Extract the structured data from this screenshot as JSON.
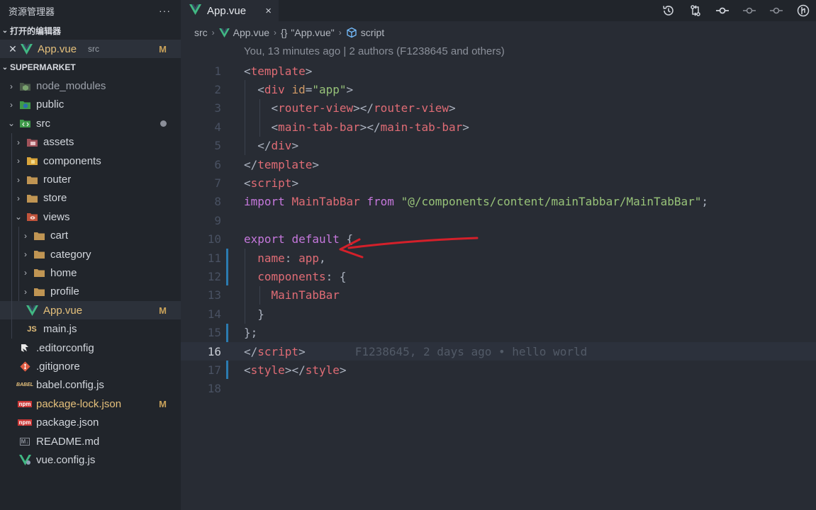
{
  "explorer": {
    "title": "资源管理器",
    "more_icon": "ellipsis-icon",
    "open_editors_label": "打开的编辑器",
    "open_editor": {
      "name": "App.vue",
      "folder": "src",
      "status": "M"
    },
    "project_label": "SUPERMARKET",
    "items": [
      {
        "name": "node_modules",
        "icon": "node-folder-icon",
        "chevron": "›"
      },
      {
        "name": "public",
        "icon": "public-folder-icon",
        "chevron": "›"
      },
      {
        "name": "src",
        "icon": "src-folder-icon",
        "chevron": "⌄"
      },
      {
        "name": "assets",
        "icon": "assets-folder-icon",
        "chevron": "›"
      },
      {
        "name": "components",
        "icon": "components-folder-icon",
        "chevron": "›"
      },
      {
        "name": "router",
        "icon": "folder-icon",
        "chevron": "›"
      },
      {
        "name": "store",
        "icon": "folder-icon",
        "chevron": "›"
      },
      {
        "name": "views",
        "icon": "views-folder-icon",
        "chevron": "⌄"
      },
      {
        "name": "cart",
        "icon": "folder-icon",
        "chevron": "›"
      },
      {
        "name": "category",
        "icon": "folder-icon",
        "chevron": "›"
      },
      {
        "name": "home",
        "icon": "folder-icon",
        "chevron": "›"
      },
      {
        "name": "profile",
        "icon": "folder-icon",
        "chevron": "›"
      },
      {
        "name": "App.vue",
        "icon": "vue-icon",
        "status": "M"
      },
      {
        "name": "main.js",
        "icon": "js-icon",
        "icon_text": "JS"
      },
      {
        "name": ".editorconfig",
        "icon": "editorconfig-icon"
      },
      {
        "name": ".gitignore",
        "icon": "git-icon"
      },
      {
        "name": "babel.config.js",
        "icon": "babel-icon",
        "icon_text": "BABEL"
      },
      {
        "name": "package-lock.json",
        "icon": "npm-icon",
        "icon_text": "npm",
        "status": "M"
      },
      {
        "name": "package.json",
        "icon": "npm-icon",
        "icon_text": "npm"
      },
      {
        "name": "README.md",
        "icon": "markdown-icon",
        "icon_text": "M↓"
      },
      {
        "name": "vue.config.js",
        "icon": "vue-config-icon"
      }
    ]
  },
  "editor": {
    "tab": {
      "label": "App.vue",
      "close": "×"
    },
    "breadcrumb": {
      "folder": "src",
      "file": "App.vue",
      "symbol_braces": "{}",
      "symbol": "\"App.vue\"",
      "leaf": "script"
    },
    "codelens": "You, 13 minutes ago | 2 authors (F1238645 and others)",
    "blame": "F1238645, 2 days ago • hello world",
    "current_line": 16,
    "action_icons": [
      "history-icon",
      "compare-changes-icon",
      "git-commit-icon",
      "previous-change-icon",
      "next-change-icon",
      "git-lens-icon"
    ],
    "lines": [
      {
        "n": "1",
        "code": [
          [
            "c-pun",
            "<"
          ],
          [
            "c-tag",
            "template"
          ],
          [
            "c-pun",
            ">"
          ]
        ]
      },
      {
        "n": "2",
        "code": [
          [
            "c-pun",
            "  <"
          ],
          [
            "c-tag",
            "div"
          ],
          [
            "c-pun",
            " "
          ],
          [
            "c-attr",
            "id"
          ],
          [
            "c-pun",
            "="
          ],
          [
            "c-str",
            "\"app\""
          ],
          [
            "c-pun",
            ">"
          ]
        ]
      },
      {
        "n": "3",
        "code": [
          [
            "c-pun",
            "    <"
          ],
          [
            "c-tag",
            "router-view"
          ],
          [
            "c-pun",
            "></"
          ],
          [
            "c-tag",
            "router-view"
          ],
          [
            "c-pun",
            ">"
          ]
        ]
      },
      {
        "n": "4",
        "code": [
          [
            "c-pun",
            "    <"
          ],
          [
            "c-tag",
            "main-tab-bar"
          ],
          [
            "c-pun",
            "></"
          ],
          [
            "c-tag",
            "main-tab-bar"
          ],
          [
            "c-pun",
            ">"
          ]
        ]
      },
      {
        "n": "5",
        "code": [
          [
            "c-pun",
            "  </"
          ],
          [
            "c-tag",
            "div"
          ],
          [
            "c-pun",
            ">"
          ]
        ]
      },
      {
        "n": "6",
        "code": [
          [
            "c-pun",
            "</"
          ],
          [
            "c-tag",
            "template"
          ],
          [
            "c-pun",
            ">"
          ]
        ]
      },
      {
        "n": "7",
        "code": [
          [
            "c-pun",
            "<"
          ],
          [
            "c-tag",
            "script"
          ],
          [
            "c-pun",
            ">"
          ]
        ]
      },
      {
        "n": "8",
        "code": [
          [
            "c-kw",
            "import"
          ],
          [
            "c-pun",
            " "
          ],
          [
            "c-var",
            "MainTabBar"
          ],
          [
            "c-pun",
            " "
          ],
          [
            "c-kw",
            "from"
          ],
          [
            "c-pun",
            " "
          ],
          [
            "c-str",
            "\"@/components/content/mainTabbar/MainTabBar\""
          ],
          [
            "c-pun",
            ";"
          ]
        ]
      },
      {
        "n": "9",
        "code": []
      },
      {
        "n": "10",
        "code": [
          [
            "c-kw",
            "export"
          ],
          [
            "c-pun",
            " "
          ],
          [
            "c-kw",
            "default"
          ],
          [
            "c-pun",
            " {"
          ]
        ]
      },
      {
        "n": "11",
        "code": [
          [
            "c-pun",
            "  "
          ],
          [
            "c-prop",
            "name"
          ],
          [
            "c-pun",
            ": "
          ],
          [
            "c-var",
            "app"
          ],
          [
            "c-pun",
            ","
          ]
        ]
      },
      {
        "n": "12",
        "code": [
          [
            "c-pun",
            "  "
          ],
          [
            "c-prop",
            "components"
          ],
          [
            "c-pun",
            ": {"
          ]
        ]
      },
      {
        "n": "13",
        "code": [
          [
            "c-pun",
            "    "
          ],
          [
            "c-var",
            "MainTabBar"
          ]
        ]
      },
      {
        "n": "14",
        "code": [
          [
            "c-pun",
            "  }"
          ]
        ]
      },
      {
        "n": "15",
        "code": [
          [
            "c-pun",
            "};"
          ]
        ]
      },
      {
        "n": "16",
        "code": [
          [
            "c-pun",
            "</"
          ],
          [
            "c-tag",
            "script"
          ],
          [
            "c-pun",
            ">"
          ]
        ]
      },
      {
        "n": "17",
        "code": [
          [
            "c-pun",
            "<"
          ],
          [
            "c-tag",
            "style"
          ],
          [
            "c-pun",
            "></"
          ],
          [
            "c-tag",
            "style"
          ],
          [
            "c-pun",
            ">"
          ]
        ]
      },
      {
        "n": "18",
        "code": []
      }
    ]
  },
  "colors": {
    "accent_blue": "#2b7bb0",
    "modified": "#e5c07b",
    "annotation_red": "#d4202a"
  }
}
